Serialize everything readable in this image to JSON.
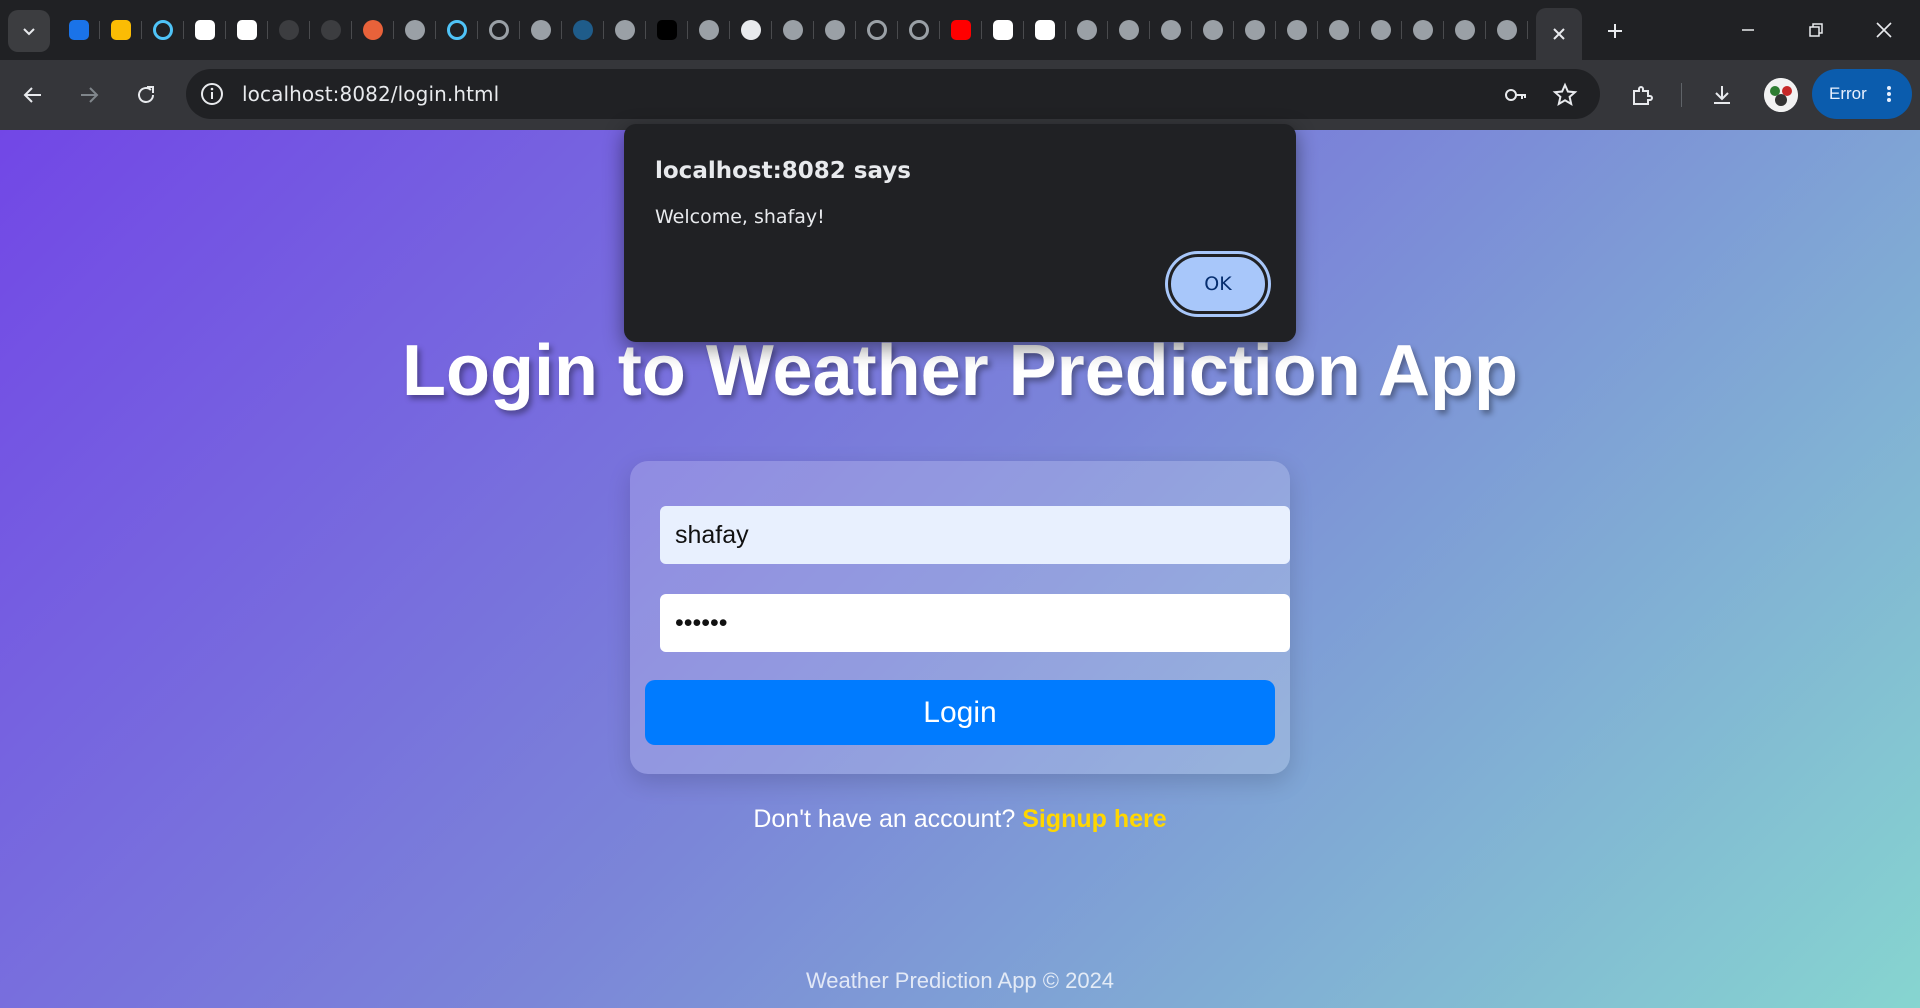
{
  "browser": {
    "tab_icons": [
      {
        "icon": "google-contacts-icon",
        "color": "#1a73e8"
      },
      {
        "icon": "google-drive-icon",
        "color": "#fbbc04"
      },
      {
        "icon": "loading-spinner-icon",
        "color": "#4fc3f7"
      },
      {
        "icon": "chatgpt-icon",
        "color": "#ffffff"
      },
      {
        "icon": "chatgpt-icon",
        "color": "#ffffff"
      },
      {
        "icon": "github-icon",
        "color": "#3c3d40"
      },
      {
        "icon": "github-icon",
        "color": "#3c3d40"
      },
      {
        "icon": "ollama-icon",
        "color": "#e8623a"
      },
      {
        "icon": "globe-icon",
        "color": "#9aa0a6"
      },
      {
        "icon": "loading-spinner-icon",
        "color": "#4fc3f7"
      },
      {
        "icon": "loading-spinner-icon",
        "color": "#9aa0a6"
      },
      {
        "icon": "globe-icon",
        "color": "#9aa0a6"
      },
      {
        "icon": "blue-logo-icon",
        "color": "#1f5c8a"
      },
      {
        "icon": "globe-icon",
        "color": "#9aa0a6"
      },
      {
        "icon": "medium-icon",
        "color": "#000000"
      },
      {
        "icon": "globe-icon",
        "color": "#9aa0a6"
      },
      {
        "icon": "chrome-icon",
        "color": "#e8eaed"
      },
      {
        "icon": "globe-icon",
        "color": "#9aa0a6"
      },
      {
        "icon": "globe-icon",
        "color": "#9aa0a6"
      },
      {
        "icon": "loading-spinner-icon",
        "color": "#9aa0a6"
      },
      {
        "icon": "loading-spinner-icon",
        "color": "#9aa0a6"
      },
      {
        "icon": "youtube-icon",
        "color": "#ff0000"
      },
      {
        "icon": "chatgpt-icon",
        "color": "#ffffff"
      },
      {
        "icon": "chatgpt-icon",
        "color": "#ffffff"
      },
      {
        "icon": "globe-icon",
        "color": "#9aa0a6"
      },
      {
        "icon": "globe-icon",
        "color": "#9aa0a6"
      },
      {
        "icon": "globe-icon",
        "color": "#9aa0a6"
      },
      {
        "icon": "globe-icon",
        "color": "#9aa0a6"
      },
      {
        "icon": "globe-icon",
        "color": "#9aa0a6"
      },
      {
        "icon": "globe-icon",
        "color": "#9aa0a6"
      },
      {
        "icon": "globe-icon",
        "color": "#9aa0a6"
      },
      {
        "icon": "globe-icon",
        "color": "#9aa0a6"
      },
      {
        "icon": "globe-icon",
        "color": "#9aa0a6"
      },
      {
        "icon": "globe-icon",
        "color": "#9aa0a6"
      },
      {
        "icon": "globe-icon",
        "color": "#9aa0a6"
      }
    ],
    "url": "localhost:8082/login.html",
    "profile_status": "Error"
  },
  "page": {
    "title": "Login to Weather Prediction App",
    "username_value": "shafay",
    "password_value": "••••••",
    "login_label": "Login",
    "signup_prompt": "Don't have an account?",
    "signup_link": "Signup here",
    "footer": "Weather Prediction App © 2024"
  },
  "alert": {
    "title": "localhost:8082 says",
    "message": "Welcome, shafay!",
    "ok_label": "OK"
  },
  "colors": {
    "gradient_start": "#7247e6",
    "gradient_end": "#86d5d0",
    "login_button": "#007bff",
    "signup_link": "#ffd700",
    "alert_ok": "#a8c7fa"
  }
}
